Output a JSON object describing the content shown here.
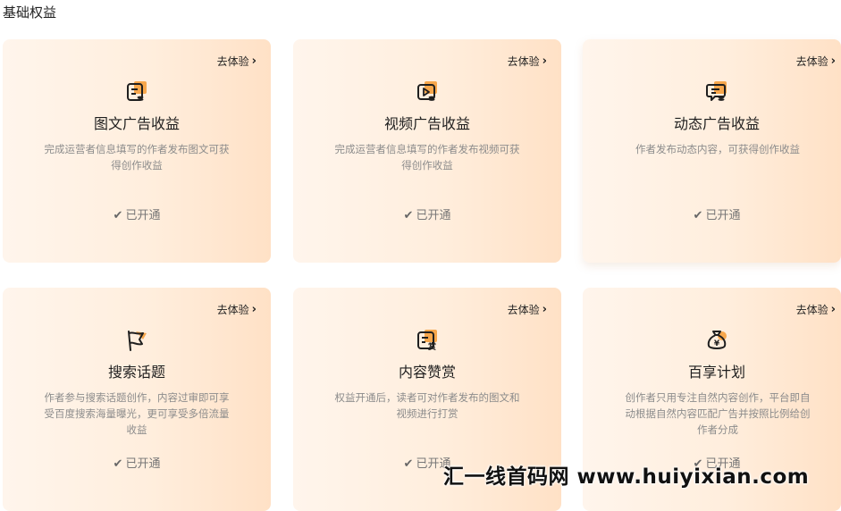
{
  "section": {
    "title": "基础权益"
  },
  "colors": {
    "accent": "#f7a74c",
    "icon_ink": "#1f1f1f",
    "card_bg_start": "#fff5ec",
    "card_bg_end": "#ffe1c6"
  },
  "cards": [
    {
      "icon": "document-list-icon",
      "try_label": "去体验",
      "title": "图文广告收益",
      "desc": "完成运营者信息填写的作者发布图文可获得创作收益",
      "status": "已开通"
    },
    {
      "icon": "video-play-icon",
      "try_label": "去体验",
      "title": "视频广告收益",
      "desc": "完成运营者信息填写的作者发布视频可获得创作收益",
      "status": "已开通"
    },
    {
      "icon": "chat-bubble-icon",
      "try_label": "去体验",
      "title": "动态广告收益",
      "desc": "作者发布动态内容，可获得创作收益",
      "status": "已开通"
    },
    {
      "icon": "flag-icon",
      "try_label": "去体验",
      "title": "搜索话题",
      "desc": "作者参与搜索话题创作，内容过审即可享受百度搜索海量曝光，更可享受多倍流量收益",
      "status": "已开通"
    },
    {
      "icon": "reward-document-icon",
      "try_label": "去体验",
      "title": "内容赞赏",
      "desc": "权益开通后，读者可对作者发布的图文和视频进行打赏",
      "status": "已开通"
    },
    {
      "icon": "money-bag-icon",
      "try_label": "去体验",
      "title": "百享计划",
      "desc": "创作者只用专注自然内容创作，平台即自动根据自然内容匹配广告并按照比例给创作者分成",
      "status": "已开通"
    }
  ],
  "watermark": "汇一线首码网 www.huiyixian.com",
  "icon_glyphs": {
    "reward_char": "赏",
    "yen_char": "¥"
  }
}
